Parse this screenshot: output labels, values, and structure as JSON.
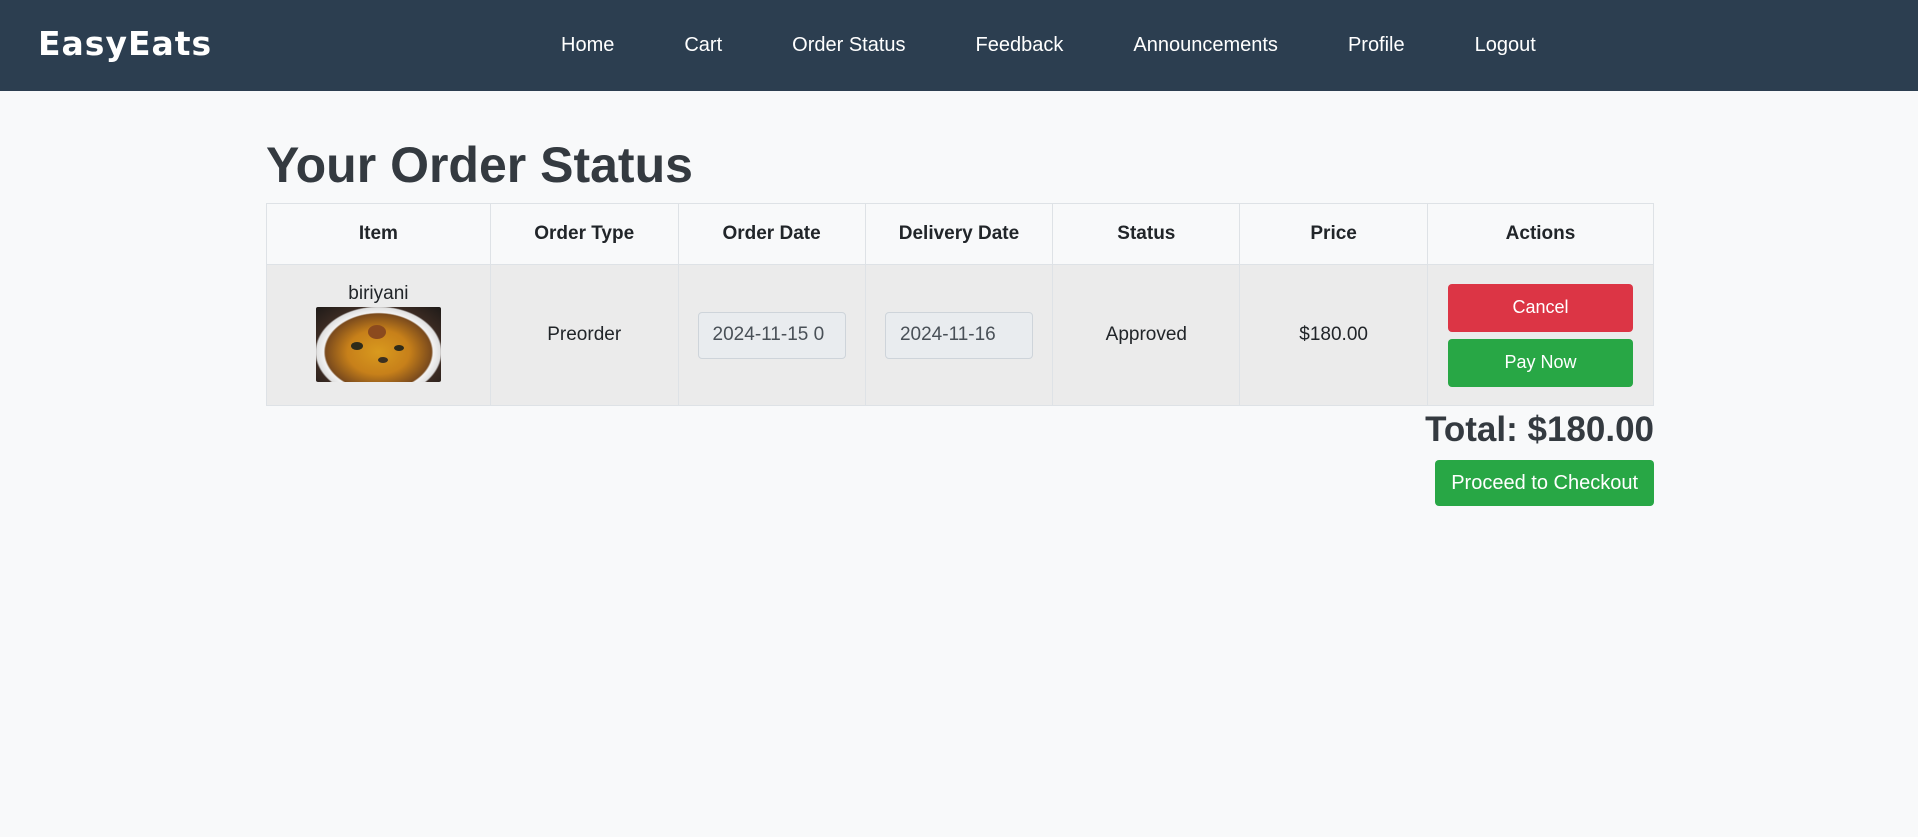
{
  "brand": "EasyEats",
  "nav": [
    {
      "label": "Home"
    },
    {
      "label": "Cart"
    },
    {
      "label": "Order Status"
    },
    {
      "label": "Feedback"
    },
    {
      "label": "Announcements"
    },
    {
      "label": "Profile"
    },
    {
      "label": "Logout"
    }
  ],
  "page_title": "Your Order Status",
  "table": {
    "headers": [
      "Item",
      "Order Type",
      "Order Date",
      "Delivery Date",
      "Status",
      "Price",
      "Actions"
    ],
    "rows": [
      {
        "item": "biriyani",
        "order_type": "Preorder",
        "order_date": "2024-11-15 0",
        "delivery_date": "2024-11-16",
        "status": "Approved",
        "price": "$180.00",
        "cancel_label": "Cancel",
        "pay_label": "Pay Now"
      }
    ]
  },
  "total": "Total: $180.00",
  "checkout_label": "Proceed to Checkout"
}
